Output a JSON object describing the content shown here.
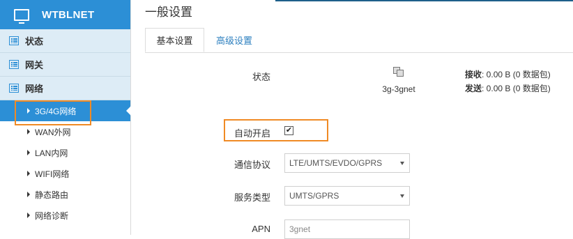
{
  "brand": {
    "title": "WTBLNET",
    "icon": "monitor-icon"
  },
  "sidebar": {
    "items": [
      {
        "label": "状态",
        "icon": "list-icon"
      },
      {
        "label": "网关",
        "icon": "list-icon"
      },
      {
        "label": "网络",
        "icon": "list-icon"
      }
    ],
    "sub_items": [
      {
        "label": "3G/4G网络",
        "active": true
      },
      {
        "label": "WAN外网"
      },
      {
        "label": "LAN内网"
      },
      {
        "label": "WIFI网络"
      },
      {
        "label": "静态路由"
      },
      {
        "label": "网络诊断"
      }
    ]
  },
  "main": {
    "title": "一般设置",
    "tabs": [
      {
        "label": "基本设置"
      },
      {
        "label": "高级设置"
      }
    ],
    "status": {
      "label": "状态",
      "icon": "network-icon",
      "interface": "3g-3gnet",
      "rx_label": "接收",
      "rx_value": ": 0.00 B (0 数据包)",
      "tx_label": "发送",
      "tx_value": ": 0.00 B (0 数据包)"
    },
    "autostart": {
      "label": "自动开启",
      "checked": true,
      "mark": "✔"
    },
    "protocol": {
      "label": "通信协议",
      "value": "LTE/UMTS/EVDO/GPRS"
    },
    "service": {
      "label": "服务类型",
      "value": "UMTS/GPRS"
    },
    "apn": {
      "label": "APN",
      "value": "3gnet"
    }
  },
  "colors": {
    "accent": "#2c8fd6",
    "highlight": "#f08a24",
    "sidebar_bg": "#ddecf6"
  }
}
